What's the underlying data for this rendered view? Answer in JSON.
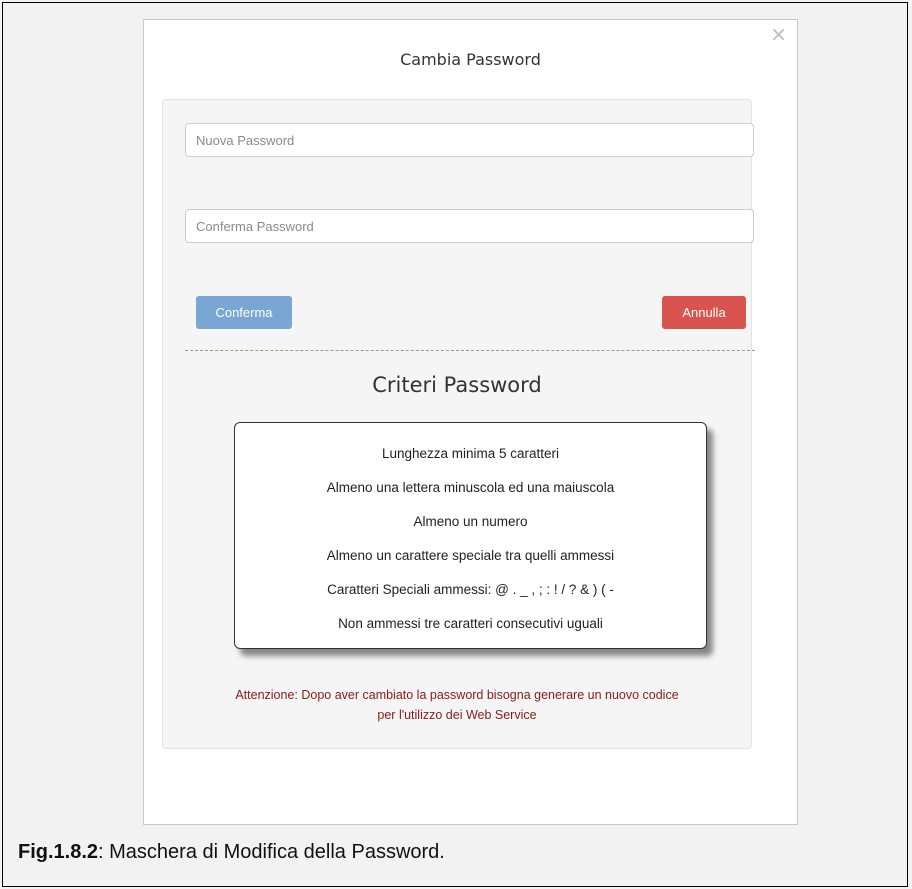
{
  "modal": {
    "title": "Cambia Password",
    "close_symbol": "×"
  },
  "form": {
    "new_password_placeholder": "Nuova Password",
    "confirm_password_placeholder": "Conferma Password",
    "confirm_label": "Conferma",
    "cancel_label": "Annulla"
  },
  "criteria": {
    "title": "Criteri Password",
    "items": [
      "Lunghezza minima 5 caratteri",
      "Almeno una lettera minuscola ed una maiuscola",
      "Almeno un numero",
      "Almeno un carattere speciale tra quelli ammessi",
      "Caratteri Speciali ammessi: @ . _ , ; : ! / ? & ) ( -",
      "Non ammessi tre caratteri consecutivi uguali"
    ]
  },
  "warning": {
    "line1": "Attenzione: Dopo aver cambiato la password bisogna generare un nuovo codice",
    "line2": "per l'utilizzo dei Web Service"
  },
  "caption": {
    "label": "Fig.1.8.2",
    "text": ": Maschera di Modifica della Password."
  },
  "colors": {
    "confirm_button": "#79a6d2",
    "cancel_button": "#d9534f",
    "warning_text": "#8b1a1a"
  }
}
